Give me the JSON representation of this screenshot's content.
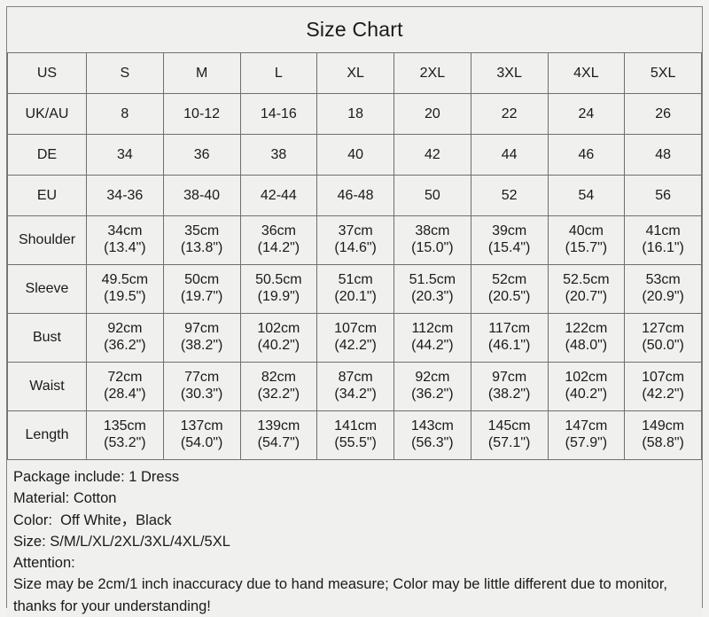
{
  "title": "Size Chart",
  "colors": {
    "header_teal": "#9cb4b1",
    "cell_bg": "#f0f0ee",
    "border": "#6f6f6f",
    "text": "#1a1a1a"
  },
  "table": {
    "size_header": {
      "label": "US",
      "sizes": [
        "S",
        "M",
        "L",
        "XL",
        "2XL",
        "3XL",
        "4XL",
        "5XL"
      ]
    },
    "region_rows": [
      {
        "label": "UK/AU",
        "values": [
          "8",
          "10-12",
          "14-16",
          "18",
          "20",
          "22",
          "24",
          "26"
        ]
      },
      {
        "label": "DE",
        "values": [
          "34",
          "36",
          "38",
          "40",
          "42",
          "44",
          "46",
          "48"
        ]
      },
      {
        "label": "EU",
        "values": [
          "34-36",
          "38-40",
          "42-44",
          "46-48",
          "50",
          "52",
          "54",
          "56"
        ]
      }
    ],
    "measure_rows": [
      {
        "label": "Shoulder",
        "cm": [
          "34cm",
          "35cm",
          "36cm",
          "37cm",
          "38cm",
          "39cm",
          "40cm",
          "41cm"
        ],
        "inch": [
          "(13.4\")",
          "(13.8\")",
          "(14.2\")",
          "(14.6\")",
          "(15.0\")",
          "(15.4\")",
          "(15.7\")",
          "(16.1\")"
        ]
      },
      {
        "label": "Sleeve",
        "cm": [
          "49.5cm",
          "50cm",
          "50.5cm",
          "51cm",
          "51.5cm",
          "52cm",
          "52.5cm",
          "53cm"
        ],
        "inch": [
          "(19.5\")",
          "(19.7\")",
          "(19.9\")",
          "(20.1\")",
          "(20.3\")",
          "(20.5\")",
          "(20.7\")",
          "(20.9\")"
        ]
      },
      {
        "label": "Bust",
        "cm": [
          "92cm",
          "97cm",
          "102cm",
          "107cm",
          "112cm",
          "117cm",
          "122cm",
          "127cm"
        ],
        "inch": [
          "(36.2\")",
          "(38.2\")",
          "(40.2\")",
          "(42.2\")",
          "(44.2\")",
          "(46.1\")",
          "(48.0\")",
          "(50.0\")"
        ]
      },
      {
        "label": "Waist",
        "cm": [
          "72cm",
          "77cm",
          "82cm",
          "87cm",
          "92cm",
          "97cm",
          "102cm",
          "107cm"
        ],
        "inch": [
          "(28.4\")",
          "(30.3\")",
          "(32.2\")",
          "(34.2\")",
          "(36.2\")",
          "(38.2\")",
          "(40.2\")",
          "(42.2\")"
        ]
      },
      {
        "label": "Length",
        "cm": [
          "135cm",
          "137cm",
          "139cm",
          "141cm",
          "143cm",
          "145cm",
          "147cm",
          "149cm"
        ],
        "inch": [
          "(53.2\")",
          "(54.0\")",
          "(54.7\")",
          "(55.5\")",
          "(56.3\")",
          "(57.1\")",
          "(57.9\")",
          "(58.8\")"
        ]
      }
    ]
  },
  "footer": {
    "package": "Package include: 1 Dress",
    "material": "Material: Cotton",
    "color": "Color:  Off White，Black",
    "size": "Size: S/M/L/XL/2XL/3XL/4XL/5XL",
    "attention_label": "Attention:",
    "attention_text": "Size may be 2cm/1 inch inaccuracy due to hand measure; Color may be little different due to monitor, thanks for your understanding!"
  }
}
